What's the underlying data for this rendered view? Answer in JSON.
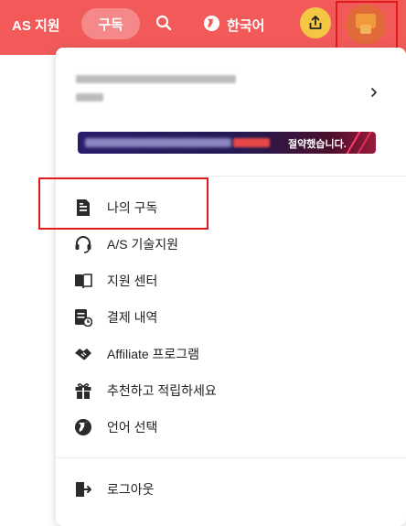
{
  "header": {
    "support_label": "AS 지원",
    "subscribe_label": "구독",
    "language_label": "한국어",
    "colors": {
      "bar": "#f25a5a",
      "share_button": "#f3c744"
    },
    "icons": [
      "search-icon",
      "globe-icon",
      "share-icon",
      "avatar"
    ]
  },
  "dropdown": {
    "account": {
      "chevron_icon": "chevron-right-icon"
    },
    "promo": {
      "text": "절약했습니다."
    },
    "menu": [
      {
        "id": "my-subscription",
        "label": "나의 구독",
        "icon": "document-icon"
      },
      {
        "id": "as-support",
        "label": "A/S 기술지원",
        "icon": "headset-icon"
      },
      {
        "id": "help-center",
        "label": "지원 센터",
        "icon": "book-icon"
      },
      {
        "id": "billing",
        "label": "결제 내역",
        "icon": "receipt-icon"
      },
      {
        "id": "affiliate",
        "label": "Affiliate 프로그램",
        "icon": "handshake-icon"
      },
      {
        "id": "refer",
        "label": "추천하고 적립하세요",
        "icon": "gift-icon"
      },
      {
        "id": "language",
        "label": "언어 선택",
        "icon": "globe-icon"
      }
    ],
    "logout_label": "로그아웃"
  }
}
